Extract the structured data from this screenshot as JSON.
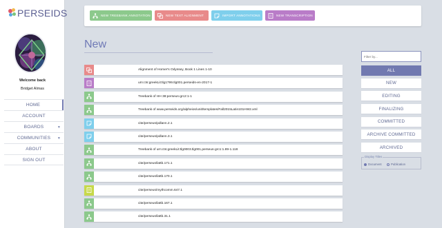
{
  "app": {
    "logo_text": "PERSEIDS"
  },
  "user": {
    "welcome": "Welcome back",
    "name": "Bridget Almas"
  },
  "nav": {
    "items": [
      {
        "label": "HOME",
        "active": true,
        "caret": false
      },
      {
        "label": "ACCOUNT",
        "active": false,
        "caret": false
      },
      {
        "label": "BOARDS",
        "active": false,
        "caret": true
      },
      {
        "label": "COMMUNITIES",
        "active": false,
        "caret": true
      },
      {
        "label": "ABOUT",
        "active": false,
        "caret": false
      },
      {
        "label": "SIGN OUT",
        "active": false,
        "caret": false
      }
    ]
  },
  "toolbar": {
    "buttons": [
      {
        "label": "NEW TREEBANK ANNOTATION",
        "icon": "treebank-icon",
        "color": "#8cc98c"
      },
      {
        "label": "NEW TEXT ALIGNMENT",
        "icon": "alignment-icon",
        "color": "#e88a8a"
      },
      {
        "label": "IMPORT ANNOTATIONS",
        "icon": "annotation-icon",
        "color": "#7fcfec"
      },
      {
        "label": "NEW TRANSCRIPTION",
        "icon": "transcription-icon",
        "color": "#b97cc8"
      }
    ]
  },
  "page": {
    "title": "New"
  },
  "list": {
    "rows": [
      {
        "text": "Alignment of Homer's Odyssey, Book 1 Lines 1-10",
        "icon": "alignment-icon",
        "color": "#e88a8a"
      },
      {
        "text": "urn:cts:greekLit:tlg1799.tlg001.perseids-en-2017-1",
        "icon": "transcription-icon",
        "color": "#b97cc8"
      },
      {
        "text": "Treebank of HH 38:perseus-grc2:1-1",
        "icon": "treebank-icon",
        "color": "#8cc98c"
      },
      {
        "text": "Treebank of www.perseids.org/alpheios/unit/templates/Fall2015Latin101HW2.xml",
        "icon": "treebank-icon",
        "color": "#8cc98c"
      },
      {
        "text": "cite/perseus/pdlann.2.1",
        "icon": "annotation-icon",
        "color": "#7fcfec"
      },
      {
        "text": "cite/perseus/pdlann.3.1",
        "icon": "annotation-icon",
        "color": "#7fcfec"
      },
      {
        "text": "Treebank of urn:cts:greekLit:tlg0003.tlg001.perseus-grc1:1.89-1.118",
        "icon": "treebank-icon",
        "color": "#8cc98c"
      },
      {
        "text": "cite/perseus/lattb.171.1",
        "icon": "treebank-icon",
        "color": "#8cc98c"
      },
      {
        "text": "cite/perseus/lattb.170.1",
        "icon": "treebank-icon",
        "color": "#8cc98c"
      },
      {
        "text": "cite/perseus/mythcomm.647.1",
        "icon": "commentary-icon",
        "color": "#c7d94a"
      },
      {
        "text": "cite/perseus/lattb.167.1",
        "icon": "treebank-icon",
        "color": "#8cc98c"
      },
      {
        "text": "cite/perseus/lattb.31.1",
        "icon": "treebank-icon",
        "color": "#8cc98c"
      }
    ]
  },
  "filter": {
    "placeholder": "Filter by...",
    "buttons": [
      {
        "label": "ALL",
        "active": true
      },
      {
        "label": "NEW",
        "active": false
      },
      {
        "label": "EDITING",
        "active": false
      },
      {
        "label": "FINALIZING",
        "active": false
      },
      {
        "label": "COMMITTED",
        "active": false
      },
      {
        "label": "ARCHIVE COMMITTED",
        "active": false
      },
      {
        "label": "ARCHIVED",
        "active": false
      }
    ],
    "display_titles": {
      "legend": "Display Titles",
      "options": [
        {
          "label": "Document",
          "selected": true
        },
        {
          "label": "Publication",
          "selected": false
        }
      ]
    }
  }
}
